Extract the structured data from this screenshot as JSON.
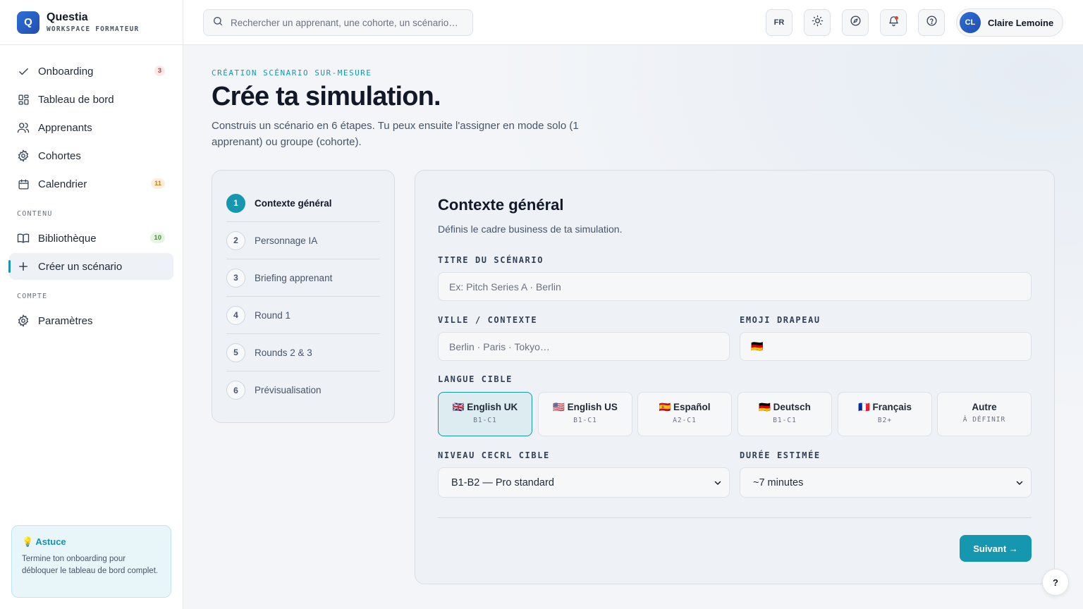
{
  "brand": {
    "logo_letter": "Q",
    "name": "Questia",
    "subtitle": "WORKSPACE FORMATEUR"
  },
  "sidebar": {
    "items": [
      {
        "label": "Onboarding",
        "icon": "check-icon",
        "badge": "3"
      },
      {
        "label": "Tableau de bord",
        "icon": "dashboard-icon"
      },
      {
        "label": "Apprenants",
        "icon": "users-icon"
      },
      {
        "label": "Cohortes",
        "icon": "gear-icon"
      },
      {
        "label": "Calendrier",
        "icon": "calendar-icon",
        "badge": "11"
      }
    ],
    "section_content": "CONTENU",
    "content_items": [
      {
        "label": "Bibliothèque",
        "icon": "book-icon",
        "badge": "10"
      },
      {
        "label": "Créer un scénario",
        "icon": "plus-icon",
        "active": true
      }
    ],
    "section_account": "COMPTE",
    "account_items": [
      {
        "label": "Paramètres",
        "icon": "gear-icon"
      }
    ],
    "tip": {
      "title": "💡 Astuce",
      "text": "Termine ton onboarding pour débloquer le tableau de bord complet."
    }
  },
  "topbar": {
    "search_placeholder": "Rechercher un apprenant, une cohorte, un scénario…",
    "lang": "FR",
    "user_initials": "CL",
    "user_name": "Claire Lemoine"
  },
  "main": {
    "eyebrow": "CRÉATION SCÉNARIO SUR-MESURE",
    "title": "Crée ta simulation.",
    "subtitle": "Construis un scénario en 6 étapes. Tu peux ensuite l'assigner en mode solo (1 apprenant) ou groupe (cohorte).",
    "steps": [
      {
        "num": "1",
        "label": "Contexte général",
        "active": true
      },
      {
        "num": "2",
        "label": "Personnage IA"
      },
      {
        "num": "3",
        "label": "Briefing apprenant"
      },
      {
        "num": "4",
        "label": "Round 1"
      },
      {
        "num": "5",
        "label": "Rounds 2 & 3"
      },
      {
        "num": "6",
        "label": "Prévisualisation"
      }
    ],
    "form": {
      "title": "Contexte général",
      "description": "Définis le cadre business de ta simulation.",
      "scenario_title_label": "TITRE DU SCÉNARIO",
      "scenario_title_placeholder": "Ex: Pitch Series A · Berlin",
      "city_label": "VILLE / CONTEXTE",
      "city_placeholder": "Berlin · Paris · Tokyo…",
      "flag_label": "EMOJI DRAPEAU",
      "flag_value": "🇩🇪",
      "language_label": "LANGUE CIBLE",
      "languages": [
        {
          "name": "🇬🇧 English UK",
          "level": "B1-C1",
          "selected": true
        },
        {
          "name": "🇺🇸 English US",
          "level": "B1-C1"
        },
        {
          "name": "🇪🇸 Español",
          "level": "A2-C1"
        },
        {
          "name": "🇩🇪 Deutsch",
          "level": "B1-C1"
        },
        {
          "name": "🇫🇷 Français",
          "level": "B2+"
        },
        {
          "name": "Autre",
          "level": "À DÉFINIR"
        }
      ],
      "cecrl_label": "NIVEAU CECRL CIBLE",
      "cecrl_value": "B1-B2 — Pro standard",
      "duration_label": "DURÉE ESTIMÉE",
      "duration_value": "~7 minutes",
      "next_button": "Suivant →"
    }
  },
  "help_button": "?",
  "colors": {
    "accent": "#1597b0",
    "brand": "#2f6fd6"
  }
}
